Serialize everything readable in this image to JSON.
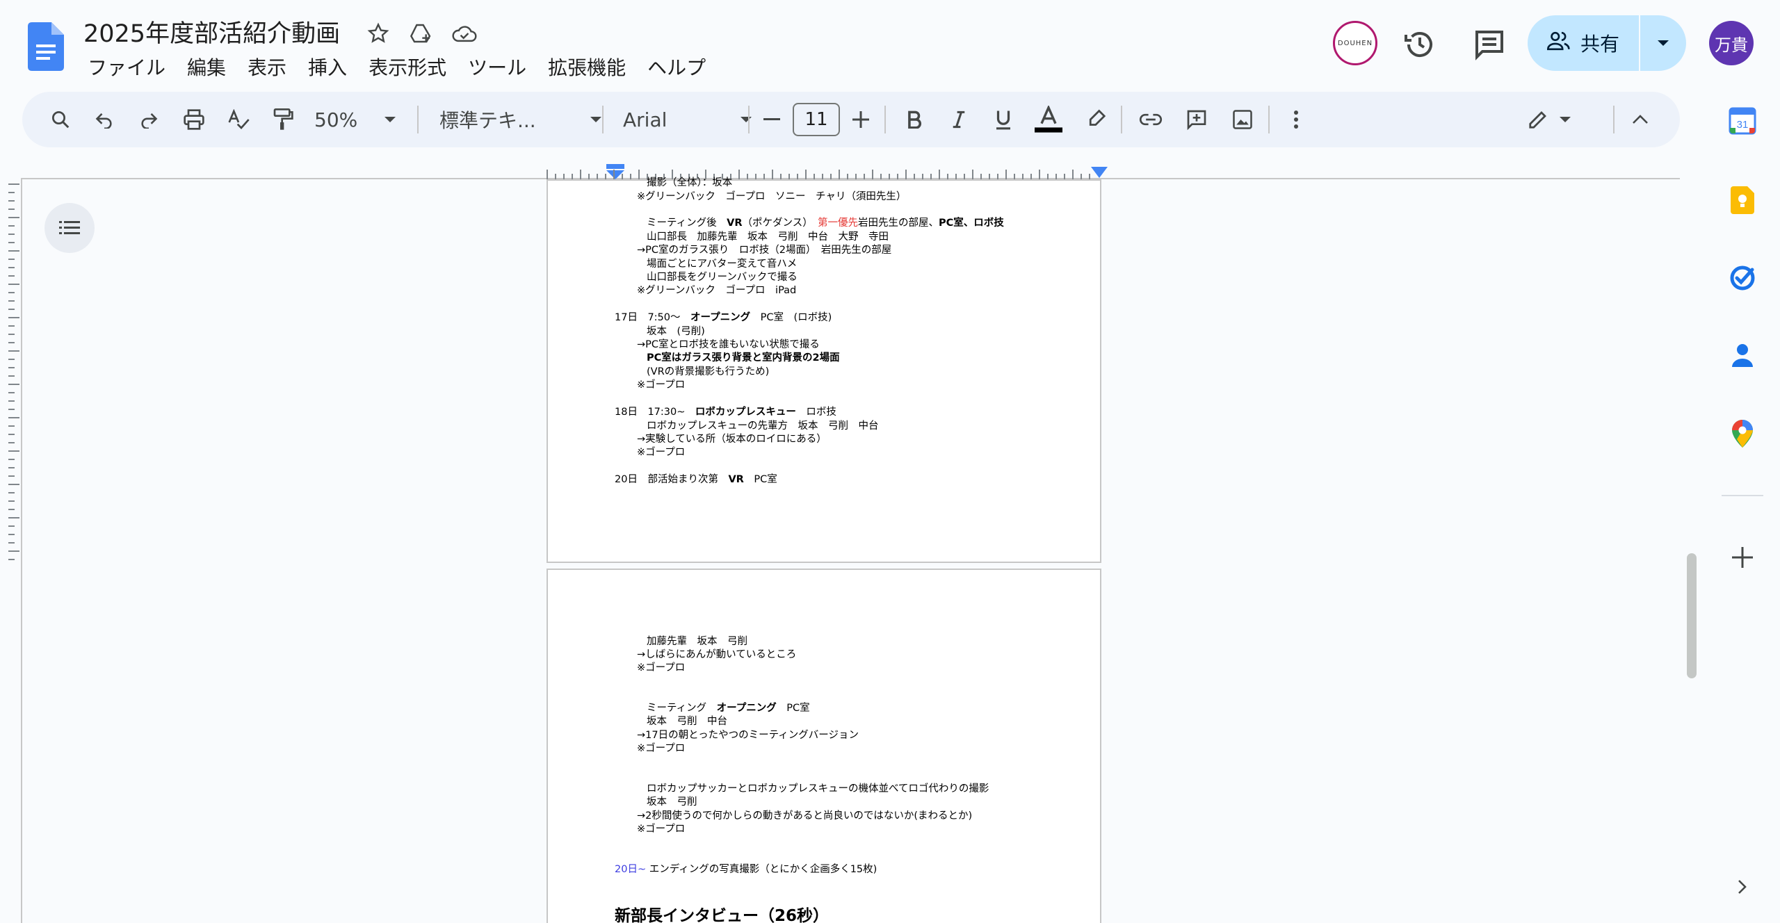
{
  "document": {
    "title": "2025年度部活紹介動画"
  },
  "menu": [
    "ファイル",
    "編集",
    "表示",
    "挿入",
    "表示形式",
    "ツール",
    "拡張機能",
    "ヘルプ"
  ],
  "header": {
    "douhen_label": "DOUHEN",
    "share_label": "共有",
    "avatar_initials": "万貴"
  },
  "toolbar": {
    "zoom": "50%",
    "style": "標準テキ...",
    "font": "Arial",
    "font_size": "11"
  },
  "colors": {
    "accent": "#0b57d0",
    "share_bg": "#c2e7ff",
    "avatar_bg": "#5e35b1",
    "red_text": "#e53935",
    "blue_text": "#3c3ce0"
  },
  "page1": {
    "lines": [
      "撮影（全体）：坂本",
      "※グリーンバック　ゴープロ　ソニー　チャリ（須田先生）",
      "ミーティング後　",
      "VR",
      "（ポケダンス）　",
      "第一優先",
      "岩田先生の部屋、",
      "PC室、ロボ技",
      "山口部長　加藤先輩　坂本　弓削　中台　大野　寺田",
      "→PC室のガラス張り　ロボ技（2場面）　岩田先生の部屋",
      "場面ごとにアバター変えて音ハメ",
      "山口部長をグリーンバックで撮る",
      "※グリーンバック　ゴープロ　iPad",
      "17日　7:50～　",
      "オープニング",
      "　PC室　(ロボ技)",
      "坂本　(弓削)",
      "→PC室とロボ技を誰もいない状態で撮る",
      "PC室はガラス張り背景と室内背景の2場面",
      "(VRの背景撮影も行うため)",
      "※ゴープロ",
      "18日　17:30~　",
      "ロボカップレスキュー",
      "　ロボ技",
      "ロボカップレスキューの先輩方　坂本　弓削　中台",
      "→実験している所（坂本のロイロにある）",
      "※ゴープロ",
      "20日　部活始まり次第　",
      "VR",
      "　PC室"
    ]
  },
  "page2": {
    "lines": [
      "加藤先輩　坂本　弓削",
      "→しばらにあんが動いているところ",
      "※ゴープロ",
      "ミーティング　",
      "オープニング",
      "　PC室",
      "坂本　弓削　中台",
      "→17日の朝とったやつのミーティングバージョン",
      "※ゴープロ",
      "ロボカップサッカーとロボカップレスキューの機体並べてロゴ代わりの撮影",
      "坂本　弓削",
      "→2秒間使うので何かしらの動きがあると尚良いのではないか(まわるとか)",
      "※ゴープロ",
      "20日~",
      "エンディングの写真撮影（とにかく企画多く15枚)"
    ],
    "heading": "新部長インタビュー（26秒）"
  },
  "sidebar": {
    "calendar_day": "31"
  }
}
